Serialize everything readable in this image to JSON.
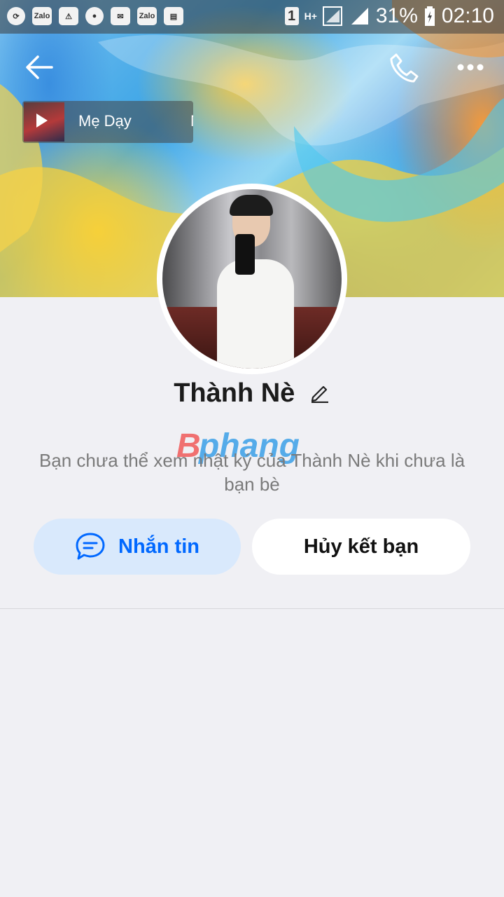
{
  "status_bar": {
    "left_icons": [
      "sync-icon",
      "zalo-icon",
      "warning-icon",
      "chat-icon",
      "mail-icon",
      "zalo-icon",
      "sd-card-icon"
    ],
    "app_label": "Zalo",
    "sim": "1",
    "network": "H+",
    "battery": "31%",
    "time": "02:10"
  },
  "header": {
    "icons": [
      "back-arrow-icon",
      "phone-icon",
      "more-icon"
    ]
  },
  "music": {
    "title": "Mẹ Dạy",
    "title_cut": "N"
  },
  "profile": {
    "name": "Thành Nè",
    "note": "Bạn chưa thể xem nhật ký của Thành Nè khi chưa là bạn bè",
    "watermark": "Bphang"
  },
  "actions": {
    "message_label": "Nhắn tin",
    "unfriend_label": "Hủy kết bạn"
  },
  "colors": {
    "accent": "#0068ff",
    "message_bg": "#d9e9fc",
    "page_bg": "#f0f0f4"
  }
}
